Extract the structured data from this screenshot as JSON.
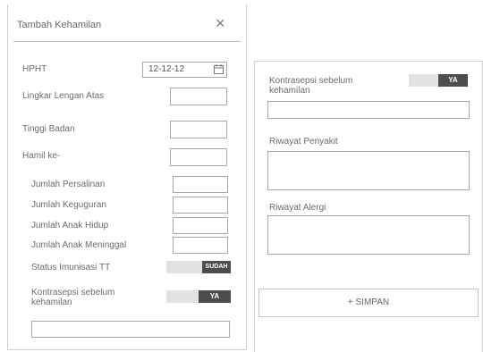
{
  "left_form": {
    "title": "Tambah Kehamilan",
    "close_label": "×",
    "hpht_label": "HPHT",
    "hpht_value": "12-12-12",
    "lingkar_label": "Lingkar Lengan Atas",
    "tinggi_label": "Tinggi Badan",
    "hamil_ke_label": "Hamil ke-",
    "persalinan_label": "Jumlah Persalinan",
    "keguguran_label": "Jumlah Keguguran",
    "anak_hidup_label": "Jumlah Anak Hidup",
    "anak_meninggal_label": "Jumlah Anak Meninggal",
    "status_tt_label": "Status Imunisasi TT",
    "status_tt_toggle": "SUDAH",
    "kontrasepsi_label": "Kontrasepsi sebelum kehamilan",
    "kontrasepsi_toggle": "YA"
  },
  "right_form": {
    "kontrasepsi_label": "Kontrasepsi sebelum kehamilan",
    "kontrasepsi_toggle": "YA",
    "riwayat_penyakit_label": "Riwayat Penyakit",
    "riwayat_alergi_label": "Riwayat Alergi",
    "simpan_label": "+ SIMPAN"
  },
  "colors": {
    "toggle_on": "#4d4d4d",
    "toggle_off": "#e2e2e2",
    "border": "#a9a9a9"
  }
}
